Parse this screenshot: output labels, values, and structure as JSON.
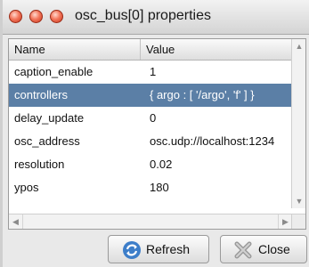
{
  "window": {
    "title": "osc_bus[0] properties"
  },
  "table": {
    "columns": {
      "name": "Name",
      "value": "Value"
    },
    "rows": [
      {
        "name": "caption_enable",
        "value": "1"
      },
      {
        "name": "controllers",
        "value": "{ argo : [ '/argo', 'f' ] }"
      },
      {
        "name": "delay_update",
        "value": "0"
      },
      {
        "name": "osc_address",
        "value": "osc.udp://localhost:1234"
      },
      {
        "name": "resolution",
        "value": "0.02"
      },
      {
        "name": "ypos",
        "value": "180"
      }
    ],
    "selected_row": "controllers"
  },
  "buttons": {
    "refresh": "Refresh",
    "close": "Close"
  },
  "colors": {
    "selection": "#5b7fa6",
    "close_traffic_light": "#e9573f"
  },
  "icons": {
    "refresh": "refresh-icon",
    "close": "close-x-icon"
  }
}
